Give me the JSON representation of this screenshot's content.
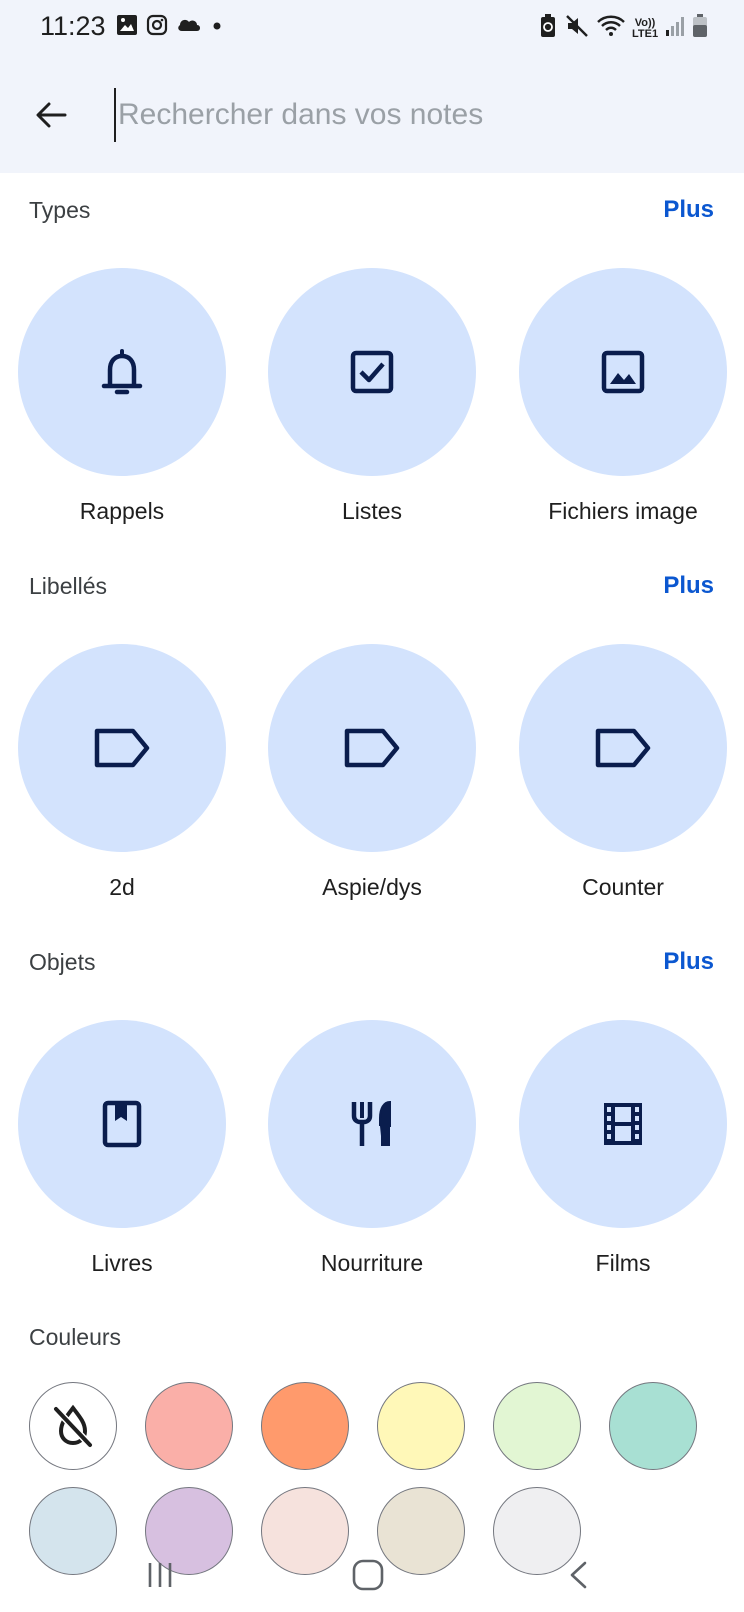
{
  "status_bar": {
    "time": "11:23",
    "left_icons": [
      "gallery-icon",
      "instagram-icon",
      "cloud-icon",
      "dot-icon"
    ],
    "right_icons": [
      "battery-saver-icon",
      "mute-icon",
      "wifi-icon",
      "volte-icon",
      "signal-icon",
      "battery-icon"
    ],
    "volte_text": "Vo)) LTE1"
  },
  "search": {
    "placeholder": "Rechercher dans vos notes",
    "value": ""
  },
  "sections": {
    "types": {
      "title": "Types",
      "more": "Plus",
      "items": [
        {
          "label": "Rappels",
          "icon": "bell-icon"
        },
        {
          "label": "Listes",
          "icon": "checkbox-icon"
        },
        {
          "label": "Fichiers image",
          "icon": "image-icon"
        }
      ]
    },
    "labels": {
      "title": "Libellés",
      "more": "Plus",
      "items": [
        {
          "label": "2d",
          "icon": "label-icon"
        },
        {
          "label": "Aspie/dys",
          "icon": "label-icon"
        },
        {
          "label": "Counter",
          "icon": "label-icon"
        }
      ]
    },
    "objects": {
      "title": "Objets",
      "more": "Plus",
      "items": [
        {
          "label": "Livres",
          "icon": "book-icon"
        },
        {
          "label": "Nourriture",
          "icon": "food-icon"
        },
        {
          "label": "Films",
          "icon": "film-icon"
        }
      ]
    },
    "colors": {
      "title": "Couleurs",
      "swatches": [
        {
          "name": "none",
          "color": "#ffffff",
          "icon": "no-color-icon"
        },
        {
          "name": "red",
          "color": "#faafa8"
        },
        {
          "name": "orange",
          "color": "#ff9a6c"
        },
        {
          "name": "yellow",
          "color": "#fff8b8"
        },
        {
          "name": "green",
          "color": "#e2f6d3"
        },
        {
          "name": "teal",
          "color": "#a8e0d3"
        },
        {
          "name": "blue",
          "color": "#d4e4ed"
        },
        {
          "name": "purple",
          "color": "#d7c0e0"
        },
        {
          "name": "pink",
          "color": "#f6e2dd"
        },
        {
          "name": "brown",
          "color": "#e9e3d4"
        },
        {
          "name": "gray",
          "color": "#efeff1"
        }
      ]
    }
  },
  "nav_bar": {
    "buttons": [
      "recents-icon",
      "home-icon",
      "back-nav-icon"
    ]
  },
  "colors": {
    "accent": "#0b57d0",
    "tile_bg": "#d3e3fd",
    "icon_dark": "#0a1d4d",
    "header_bg": "#f1f4fb"
  }
}
